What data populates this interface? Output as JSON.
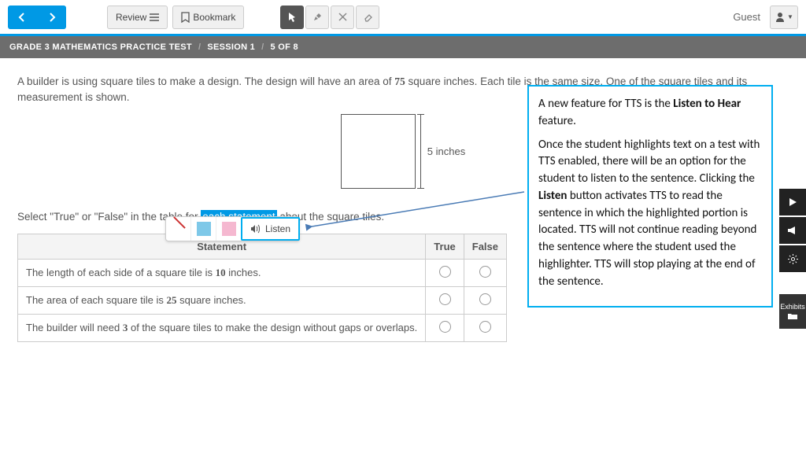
{
  "topbar": {
    "review": "Review",
    "bookmark": "Bookmark",
    "guest": "Guest"
  },
  "breadcrumb": {
    "test": "GRADE 3 MATHEMATICS PRACTICE TEST",
    "session": "SESSION 1",
    "progress": "5 OF 8"
  },
  "question": {
    "prompt_a": "A builder is using square tiles to make a design. The design will have an area of ",
    "prompt_num": "75",
    "prompt_b": " square inches. Each tile is the same size. One of the square tiles and its measurement is shown.",
    "measure_label": "5 inches",
    "instruction_a": "Select \"True\" or \"False\" in the table for ",
    "instruction_hl": "each statement",
    "instruction_b": " about the square tiles."
  },
  "listen": {
    "label": "Listen"
  },
  "table": {
    "h_statement": "Statement",
    "h_true": "True",
    "h_false": "False",
    "rows": [
      {
        "a": "The length of each side of a square tile is ",
        "n": "10",
        "b": " inches."
      },
      {
        "a": "The area of each square tile is ",
        "n": "25",
        "b": " square inches."
      },
      {
        "a": "The builder will need ",
        "n": "3",
        "b": " of the square tiles to make the design without gaps or overlaps."
      }
    ]
  },
  "callout": {
    "p1_a": "A new feature for TTS is the ",
    "p1_b": "Listen to Hear",
    "p1_c": " feature.",
    "p2_a": "Once the student highlights text on a test with TTS enabled, there will be an option for the student to listen to the sentence. Clicking the ",
    "p2_b": "Listen",
    "p2_c": " button activates TTS to read the sentence in which the highlighted portion is located. TTS will not continue reading beyond the sentence where the student used the highlighter. TTS will stop playing at the end of the sentence."
  },
  "side": {
    "exhibits": "Exhibits"
  }
}
